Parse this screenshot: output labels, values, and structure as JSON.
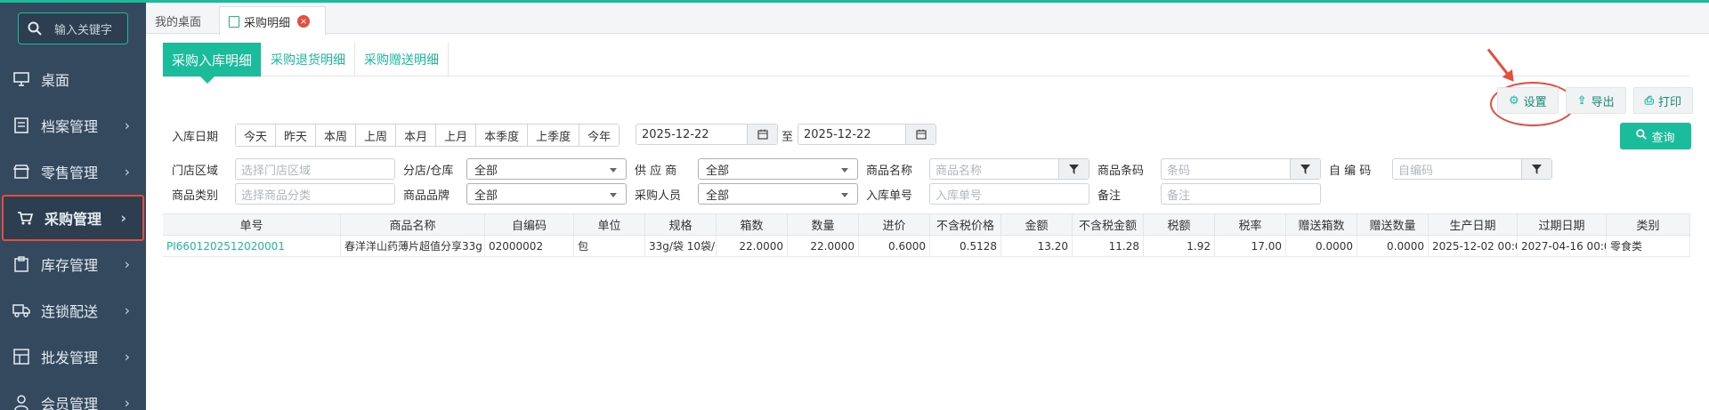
{
  "sidebar": {
    "search_placeholder": "输入关键字",
    "items": [
      {
        "label": "桌面",
        "icon": "monitor-icon",
        "arrow": ""
      },
      {
        "label": "档案管理",
        "icon": "archive-icon",
        "arrow": "›"
      },
      {
        "label": "零售管理",
        "icon": "retail-icon",
        "arrow": "›"
      },
      {
        "label": "采购管理",
        "icon": "purchase-icon",
        "arrow": "›"
      },
      {
        "label": "库存管理",
        "icon": "inventory-icon",
        "arrow": "›"
      },
      {
        "label": "连锁配送",
        "icon": "truck-icon",
        "arrow": "›"
      },
      {
        "label": "批发管理",
        "icon": "wholesale-icon",
        "arrow": "›"
      },
      {
        "label": "会员管理",
        "icon": "user-icon",
        "arrow": "›"
      }
    ]
  },
  "tabs": {
    "home": "我的桌面",
    "current": "采购明细",
    "close_glyph": "×"
  },
  "subtabs": [
    "采购入库明细",
    "采购退货明细",
    "采购赠送明细"
  ],
  "toolbar": {
    "settings": "设置",
    "export": "导出",
    "print": "打印"
  },
  "query_button": "查询",
  "filters": {
    "date_label": "入库日期",
    "quick_ranges": [
      "今天",
      "昨天",
      "本周",
      "上周",
      "本月",
      "上月",
      "本季度",
      "上季度",
      "今年"
    ],
    "date_from": "2025-12-22",
    "date_to_label": "至",
    "date_to": "2025-12-22",
    "region_label": "门店区域",
    "region_placeholder": "选择门店区域",
    "store_label": "分店/仓库",
    "store_value": "全部",
    "supplier_label": "供 应 商",
    "supplier_value": "全部",
    "product_name_label": "商品名称",
    "product_name_placeholder": "商品名称",
    "barcode_label": "商品条码",
    "barcode_placeholder": "条码",
    "selfcode_label": "自 编 码",
    "selfcode_placeholder": "自编码",
    "category_label": "商品类别",
    "category_placeholder": "选择商品分类",
    "brand_label": "商品品牌",
    "brand_value": "全部",
    "buyer_label": "采购人员",
    "buyer_value": "全部",
    "order_label": "入库单号",
    "order_placeholder": "入库单号",
    "remark_label": "备注",
    "remark_placeholder": "备注"
  },
  "table": {
    "columns": [
      "单号",
      "商品名称",
      "自编码",
      "单位",
      "规格",
      "箱数",
      "数量",
      "进价",
      "不含税价格",
      "金额",
      "不含税金额",
      "税额",
      "税率",
      "赠送箱数",
      "赠送数量",
      "生产日期",
      "过期日期",
      "类别"
    ],
    "rows": [
      [
        "PI6601202512020001",
        "春洋洋山药薄片超值分享33g",
        "02000002",
        "包",
        "33g/袋 10袋/",
        "22.0000",
        "22.0000",
        "0.6000",
        "0.5128",
        "13.20",
        "11.28",
        "1.92",
        "17.00",
        "0.0000",
        "0.0000",
        "2025-12-02 00:0",
        "2027-04-16 00:0",
        "零食类"
      ]
    ]
  }
}
